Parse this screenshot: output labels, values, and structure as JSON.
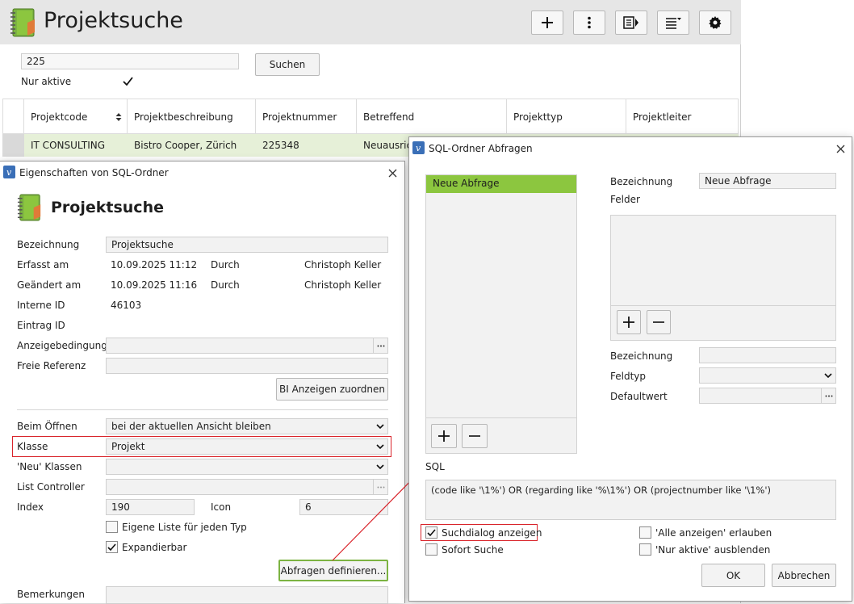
{
  "main": {
    "title": "Projektsuche",
    "search_value": "225",
    "search_button": "Suchen",
    "nur_aktive_label": "Nur aktive",
    "columns": [
      "Projektcode",
      "Projektbeschreibung",
      "Projektnummer",
      "Betreffend",
      "Projekttyp",
      "Projektleiter"
    ],
    "row": [
      "IT CONSULTING",
      "Bistro Cooper, Zürich",
      "225348",
      "Neuausrich"
    ],
    "accent_color": "#7cb342",
    "row_highlight": "#e6f0d8"
  },
  "props": {
    "window_title": "Eigenschaften von SQL-Ordner",
    "heading": "Projektsuche",
    "bezeichnung_label": "Bezeichnung",
    "bezeichnung_value": "Projektsuche",
    "erfasst_label": "Erfasst am",
    "erfasst_value": "10.09.2025 11:12",
    "geaendert_label": "Geändert am",
    "geaendert_value": "10.09.2025 11:16",
    "durch_label": "Durch",
    "durch_value": "Christoph Keller",
    "interne_id_label": "Interne ID",
    "interne_id_value": "46103",
    "eintrag_id_label": "Eintrag ID",
    "anzeigebedingung_label": "Anzeigebedingung",
    "freie_referenz_label": "Freie Referenz",
    "bi_button": "BI Anzeigen zuordnen",
    "beim_oeffnen_label": "Beim Öffnen",
    "beim_oeffnen_value": "bei der aktuellen Ansicht bleiben",
    "klasse_label": "Klasse",
    "klasse_value": "Projekt",
    "neu_klassen_label": "'Neu' Klassen",
    "list_controller_label": "List Controller",
    "index_label": "Index",
    "index_value": "190",
    "icon_label": "Icon",
    "icon_value": "6",
    "eigene_liste_label": "Eigene Liste für jeden Typ",
    "expandierbar_label": "Expandierbar",
    "abfragen_button": "Abfragen definieren...",
    "bemerkungen_label": "Bemerkungen"
  },
  "sql": {
    "window_title": "SQL-Ordner Abfragen",
    "query_item": "Neue Abfrage",
    "bezeichnung_label": "Bezeichnung",
    "bezeichnung_value": "Neue Abfrage",
    "felder_label": "Felder",
    "bezeichnung2_label": "Bezeichnung",
    "feldtyp_label": "Feldtyp",
    "defaultwert_label": "Defaultwert",
    "sql_label": "SQL",
    "sql_value": "(code like '\\1%') OR (regarding like '%\\1%') OR (projectnumber like '\\1%')",
    "suchdialog_label": "Suchdialog anzeigen",
    "sofort_label": "Sofort Suche",
    "alle_label": "'Alle anzeigen' erlauben",
    "nur_aktive_label": "'Nur aktive' ausblenden",
    "ok_button": "OK",
    "cancel_button": "Abbrechen"
  },
  "icons": {
    "app": "notebook-icon",
    "dialog": "v-logo-icon"
  },
  "colors": {
    "highlight_red": "#d9242b",
    "green_border": "#7cb342",
    "selection": "#8cc63f"
  }
}
